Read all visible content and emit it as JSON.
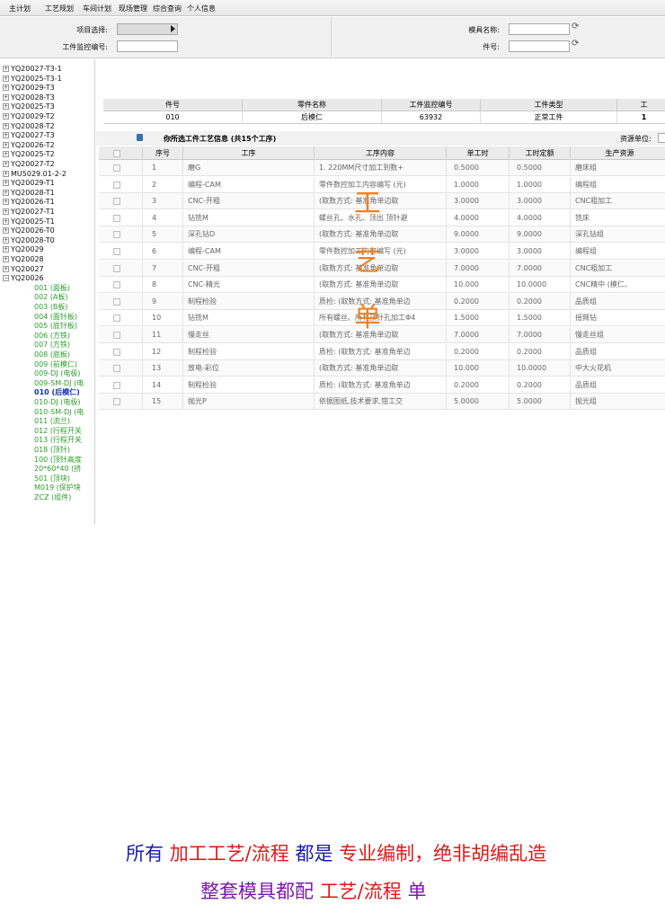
{
  "menu": [
    "主计划",
    "工艺规划",
    "车间计划",
    "现场管理",
    "综合查询",
    "个人信息"
  ],
  "filters": {
    "project_label": "项目选择:",
    "mold_name_label": "模具名称:",
    "monitor_label": "工件监控编号:",
    "part_no_label": "件号:"
  },
  "tree": {
    "roots": [
      "YQ20027-T3-1",
      "YQ20025-T3-1",
      "YQ20029-T3",
      "YQ20028-T3",
      "YQ20025-T3",
      "YQ20029-T2",
      "YQ20028-T2",
      "YQ20027-T3",
      "YQ20026-T2",
      "YQ20025-T2",
      "YQ20027-T2",
      "MU5029.01-2-2",
      "YQ20029-T1",
      "YQ20028-T1",
      "YQ20026-T1",
      "YQ20027-T1",
      "YQ20025-T1",
      "YQ20026-T0",
      "YQ20028-T0",
      "YQ20029",
      "YQ20028",
      "YQ20027",
      "YQ20026"
    ],
    "children": [
      "001 (面板)",
      "002 (A板)",
      "003 (B板)",
      "004 (面针板)",
      "005 (底针板)",
      "006 (方铁)",
      "007 (方铁)",
      "008 (底板)",
      "009 (前模仁)",
      "009-DJ (电极)",
      "009-SM-DJ (电",
      "010 (后模仁)",
      "010-DJ (电极)",
      "010-SM-DJ (电",
      "011 (流兰)",
      "012 (行程开关",
      "013 (行程开关",
      "018 (顶针)",
      "100 (顶针高度",
      "20*60*40 (挤",
      "501 (顶块)",
      "M019 (保护块",
      "ZCZ (组件)"
    ]
  },
  "info": {
    "headers": [
      "件号",
      "零件名称",
      "工件监控编号",
      "工件类型",
      "工"
    ],
    "values": [
      "010",
      "后模仁",
      "63932",
      "正常工件",
      "1"
    ]
  },
  "section": {
    "title": "你所选工件工艺信息 (共15个工序)",
    "unit_label": "资源单位:"
  },
  "grid": {
    "headers": [
      "序号",
      "工序",
      "工序内容",
      "单工时",
      "工时定额",
      "生产资源"
    ],
    "rows": [
      [
        "1",
        "磨G",
        "1. 220MM尺寸加工到数+",
        "0.5000",
        "0.5000",
        "磨床组"
      ],
      [
        "2",
        "编程-CAM",
        "零件数控加工内容编写 (元)",
        "1.0000",
        "1.0000",
        "编程组"
      ],
      [
        "3",
        "CNC-开粗",
        "(取数方式: 基准角单边取",
        "3.0000",
        "3.0000",
        "CNC粗加工"
      ],
      [
        "4",
        "钻铣M",
        "螺丝孔、水孔、顶出 顶针避",
        "4.0000",
        "4.0000",
        "铣床"
      ],
      [
        "5",
        "深孔钻D",
        "(取数方式: 基准角单边取",
        "9.0000",
        "9.0000",
        "深孔钻组"
      ],
      [
        "6",
        "编程-CAM",
        "零件数控加工内容编写 (元)",
        "3.0000",
        "3.0000",
        "编程组"
      ],
      [
        "7",
        "CNC-开粗",
        "(取数方式: 基准角单边取",
        "7.0000",
        "7.0000",
        "CNC粗加工"
      ],
      [
        "8",
        "CNC-精光",
        "(取数方式: 基准角单边取",
        "10.000",
        "10.0000",
        "CNC精中 (模仁、"
      ],
      [
        "9",
        "制程检验",
        "质检: (取数方式: 基准角单边",
        "0.2000",
        "0.2000",
        "品质组"
      ],
      [
        "10",
        "钻铣M",
        "所有螺丝、所有顶针孔加工Φ4",
        "1.5000",
        "1.5000",
        "摇臂钻"
      ],
      [
        "11",
        "慢走丝",
        "(取数方式: 基准角单边取",
        "7.0000",
        "7.0000",
        "慢走丝组"
      ],
      [
        "12",
        "制程检验",
        "质检: (取数方式: 基准角单边",
        "0.2000",
        "0.2000",
        "品质组"
      ],
      [
        "13",
        "放电-彩位",
        "(取数方式: 基准角单边取",
        "10.000",
        "10.0000",
        "中大火花机"
      ],
      [
        "14",
        "制程检验",
        "质检: (取数方式: 基准角单边",
        "0.2000",
        "0.2000",
        "品质组"
      ],
      [
        "15",
        "抛光P",
        "依据图纸,技术要求,钳工交",
        "5.0000",
        "5.0000",
        "抛光组"
      ]
    ]
  },
  "overlay_chars": [
    "工",
    "艺",
    "单"
  ],
  "caption": {
    "line1_parts": [
      "所有 ",
      "加工工艺/流程",
      " 都是 ",
      "专业编制，绝非胡编乱造"
    ],
    "line2_parts": [
      "整套模具都配 ",
      "工艺/流程",
      " 单"
    ]
  },
  "colors": {
    "tree_child": "#2c9e2c",
    "selected": "#1030b0",
    "overlay": "#f08020",
    "cap_blue": "#1a1ab0",
    "cap_red": "#e01818",
    "cap_purple": "#7a1aa8"
  },
  "icons": {
    "expand": "plus-box-icon",
    "collapse": "minus-box-icon",
    "refresh": "refresh-icon",
    "dropdown": "dropdown-arrow-icon",
    "section": "cube-icon"
  }
}
